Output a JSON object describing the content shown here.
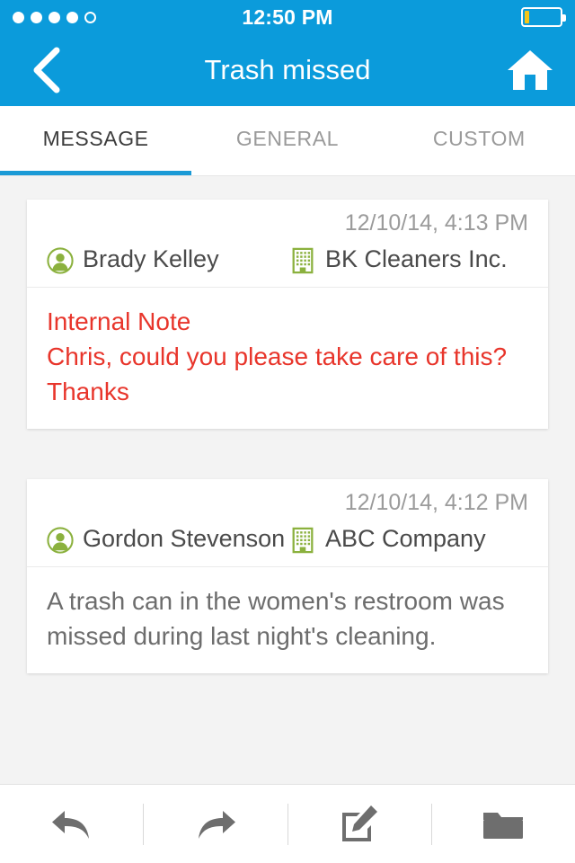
{
  "statusbar": {
    "time": "12:50 PM",
    "signal_dots_filled": 4,
    "signal_dots_total": 5,
    "battery_level_pct": 14,
    "battery_color": "#f5c518"
  },
  "navbar": {
    "title": "Trash missed",
    "back_icon": "chevron-left-icon",
    "home_icon": "home-icon",
    "background_color": "#0b9bdb"
  },
  "tabs": [
    {
      "label": "MESSAGE",
      "active": true
    },
    {
      "label": "GENERAL",
      "active": false
    },
    {
      "label": "CUSTOM",
      "active": false
    }
  ],
  "tab_accent_color": "#1a9ad6",
  "messages": [
    {
      "date": "12/10/14, 4:13 PM",
      "person_icon": "person-icon",
      "person": "Brady Kelley",
      "company_icon": "building-icon",
      "company": "BK Cleaners Inc.",
      "body": "Internal Note\nChris, could you please take care of this? Thanks",
      "is_internal_note": true,
      "body_color": "#e8352b"
    },
    {
      "date": "12/10/14, 4:12 PM",
      "person_icon": "person-icon",
      "person": "Gordon Stevenson",
      "company_icon": "building-icon",
      "company": "ABC Company",
      "body": "A trash can in the women's restroom was missed during last night's cleaning.",
      "is_internal_note": false,
      "body_color": "#6d6d6d"
    }
  ],
  "toolbar": [
    {
      "name": "reply-button",
      "icon": "reply-arrow-icon"
    },
    {
      "name": "forward-button",
      "icon": "forward-arrow-icon"
    },
    {
      "name": "compose-button",
      "icon": "compose-pencil-icon"
    },
    {
      "name": "folder-button",
      "icon": "folder-icon"
    }
  ],
  "icon_colors": {
    "green": "#8bb13e",
    "toolbar_gray": "#6e6e6e"
  }
}
